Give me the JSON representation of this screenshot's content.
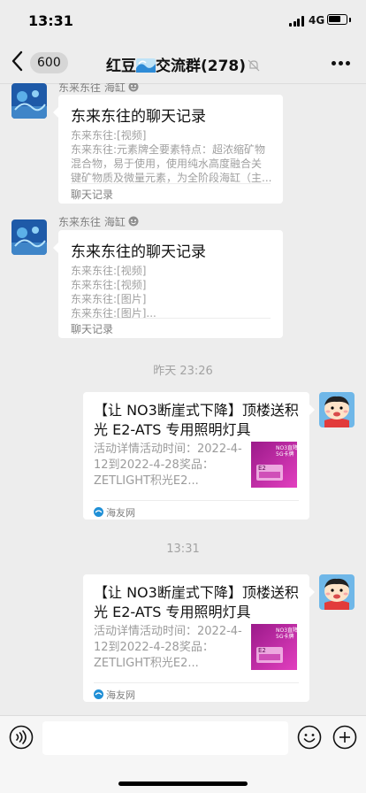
{
  "status_bar": {
    "time": "13:31",
    "network": "4G",
    "battery_level": 0.7
  },
  "nav": {
    "unread_count": "600",
    "title_prefix": "红豆",
    "title_suffix": "交流群(278)"
  },
  "messages": [
    {
      "type": "chat_record",
      "sender": "东来东往 海缸",
      "title": "东来东往的聊天记录",
      "lines": [
        "东来东往:[视频]",
        "东来东往:元素牌全要素特点：超浓缩矿物",
        "混合物，易于使用，使用纯水高度融合关",
        "键矿物质及微量元素，为全阶段海缸（主..."
      ],
      "footer": "聊天记录"
    },
    {
      "type": "chat_record",
      "sender": "东来东往 海缸",
      "title": "东来东往的聊天记录",
      "lines": [
        "东来东往:[视频]",
        "东来东往:[视频]",
        "东来东往:[图片]",
        "东来东往:[图片]..."
      ],
      "footer": "聊天记录"
    },
    {
      "type": "time",
      "text": "昨天 23:26"
    },
    {
      "type": "link",
      "title": "【让 NO3断崖式下降】顶楼送积光 E2-ATS 专用照明灯具",
      "desc": "活动详情活动时间：2022-4-12到2022-4-28奖品：ZETLIGHT积光E2...",
      "source": "海友网"
    },
    {
      "type": "time",
      "text": "13:31"
    },
    {
      "type": "link",
      "title": "【让 NO3断崖式下降】顶楼送积光 E2-ATS 专用照明灯具",
      "desc": "活动详情活动时间：2022-4-12到2022-4-28奖品：ZETLIGHT积光E2...",
      "source": "海友网"
    }
  ],
  "thumbnail": {
    "line1": "NO3直降",
    "line2": "5G卡牌",
    "line3": "E2"
  },
  "input": {
    "placeholder": ""
  },
  "colors": {
    "background": "#ededed",
    "bubble": "#ffffff",
    "muted_text": "#a0a0a0"
  }
}
